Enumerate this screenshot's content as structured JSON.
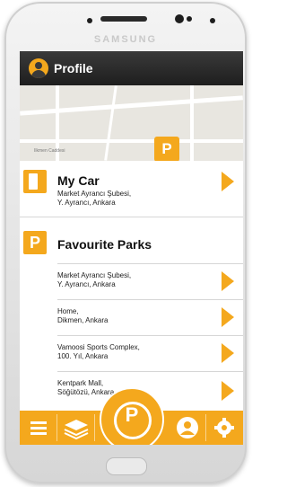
{
  "device": {
    "brand": "SAMSUNG"
  },
  "header": {
    "title": "Profile"
  },
  "map": {
    "street_label": "Ilkmen Caddesi",
    "pin_letter": "P"
  },
  "my_car": {
    "title": "My Car",
    "line1": "Market Ayrancı Şubesi,",
    "line2": "Y. Ayrancı, Ankara"
  },
  "favourites": {
    "icon_letter": "P",
    "title": "Favourite Parks",
    "items": [
      {
        "line1": "Market Ayrancı Şubesi,",
        "line2": "Y. Ayrancı, Ankara"
      },
      {
        "line1": "Home,",
        "line2": "Dikmen, Ankara"
      },
      {
        "line1": "Vamoosi Sports Complex,",
        "line2": "100. Yıl, Ankara"
      },
      {
        "line1": "Kentpark Mall,",
        "line2": "Söğütözü, Ankara"
      }
    ]
  },
  "bottom_nav": {
    "center_letter": "P",
    "items": [
      "menu-icon",
      "layers-icon",
      "park-button",
      "user-icon",
      "settings-icon"
    ]
  },
  "colors": {
    "accent": "#f4a81d",
    "topbar": "#2a2a2a"
  }
}
